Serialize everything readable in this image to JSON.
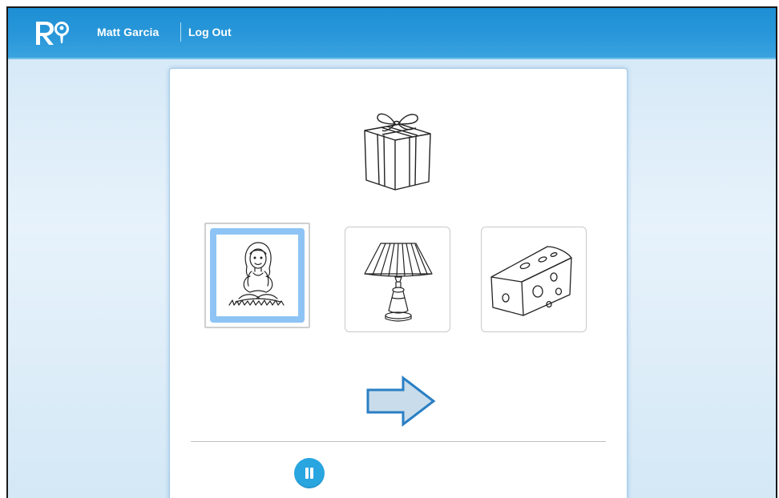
{
  "header": {
    "logo_text": "RQ",
    "user_name": "Matt Garcia",
    "logout_label": "Log Out"
  },
  "activity": {
    "prompt_picture": "gift-box",
    "choices": [
      {
        "picture": "girl-sitting",
        "selected": true
      },
      {
        "picture": "lamp",
        "selected": false
      },
      {
        "picture": "cheese",
        "selected": false
      }
    ],
    "next_icon": "right-arrow-icon",
    "pause_icon": "pause-icon"
  },
  "colors": {
    "header_blue": "#1e8fd5",
    "selection_blue": "#8ec4f5",
    "arrow_fill": "#c9dceb",
    "arrow_stroke": "#2a7fc4",
    "pause_blue": "#29a5e0"
  }
}
